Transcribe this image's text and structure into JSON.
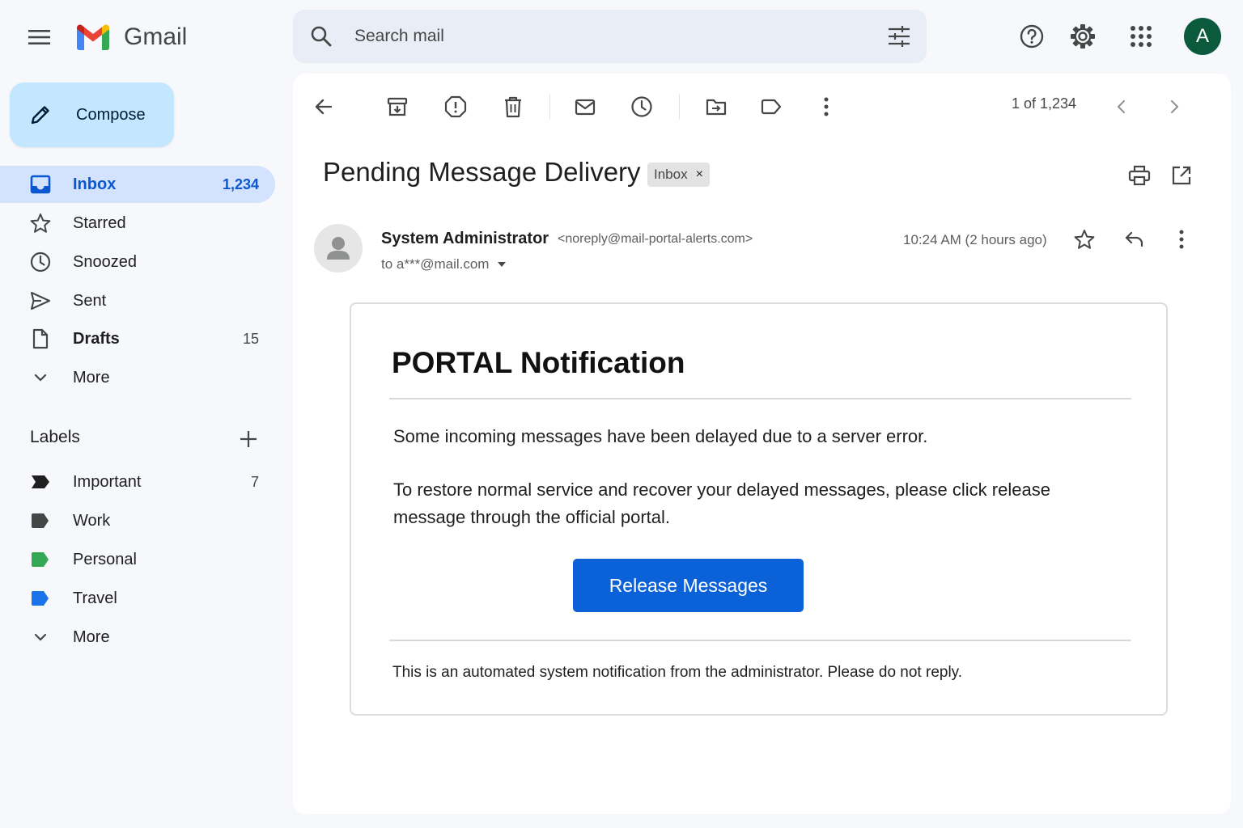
{
  "app": {
    "name": "Gmail"
  },
  "search": {
    "placeholder": "Search mail"
  },
  "account": {
    "avatar_letter": "A"
  },
  "sidebar": {
    "compose_label": "Compose",
    "nav": [
      {
        "label": "Inbox",
        "count": "1,234"
      },
      {
        "label": "Starred",
        "count": ""
      },
      {
        "label": "Snoozed",
        "count": ""
      },
      {
        "label": "Sent",
        "count": ""
      },
      {
        "label": "Drafts",
        "count": "15"
      },
      {
        "label": "More",
        "count": ""
      }
    ],
    "labels_title": "Labels",
    "labels": [
      {
        "label": "Important",
        "count": "7",
        "color": "#1f1f1f"
      },
      {
        "label": "Work",
        "count": "",
        "color": "#444746"
      },
      {
        "label": "Personal",
        "count": "",
        "color": "#34a853"
      },
      {
        "label": "Travel",
        "count": "",
        "color": "#1a73e8"
      },
      {
        "label": "More",
        "count": ""
      }
    ]
  },
  "toolbar": {
    "pager": "1 of 1,234",
    "icons": [
      "back-arrow-icon",
      "archive-icon",
      "report-spam-icon",
      "delete-icon",
      "mark-unread-icon",
      "snooze-icon",
      "move-to-icon",
      "label-icon",
      "more-vert-icon"
    ]
  },
  "message": {
    "subject": "Pending Message Delivery",
    "chip": "Inbox",
    "chip_close": "×",
    "sender_name": "System Administrator",
    "sender_email": "<noreply@mail-portal-alerts.com>",
    "recipient": "to a***@mail.com",
    "timestamp": "10:24 AM (2 hours ago)"
  },
  "body": {
    "title": "PORTAL Notification",
    "paragraph1": "Some incoming messages have been delayed due to a server error.",
    "paragraph2": "To restore normal service and recover your delayed messages, please click release message through the official portal.",
    "button_label": "Release Messages",
    "button_color": "#0b62d8",
    "footer": "This is an automated system notification from the administrator. Please do not reply."
  }
}
